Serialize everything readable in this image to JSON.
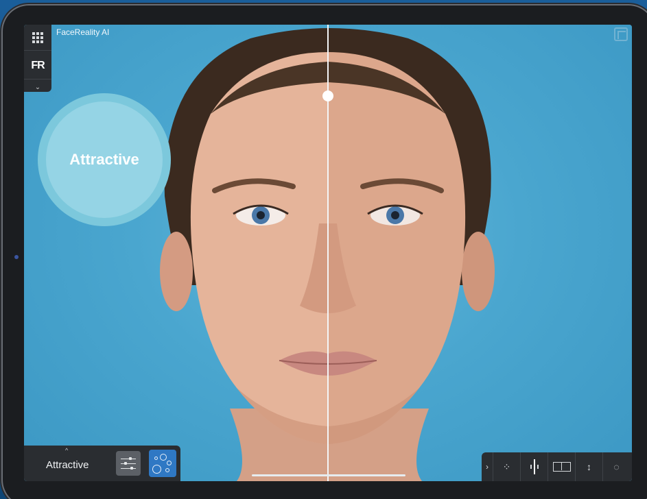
{
  "app": {
    "title": "FaceReality AI",
    "logo_text": "FR"
  },
  "bubble": {
    "label": "Attractive"
  },
  "bottom_panel": {
    "mode_label": "Attractive"
  },
  "colors": {
    "screen_background": "#47a5cc",
    "bubble_outer": "#7cc8dc",
    "bubble_inner": "#95d4e5",
    "panel_dark": "#2a2d31",
    "active_button": "#2f78c4"
  },
  "icons": {
    "menu": "grid-icon",
    "collapse": "chevron-down-icon",
    "expand_mode": "chevron-up-icon",
    "settings": "sliders-icon",
    "bubbles": "bubbles-icon",
    "fullscreen": "expand-icon",
    "toolbar": [
      "chevron-right-icon",
      "sparkle-icon",
      "divider-icon",
      "split-view-icon",
      "arrows-icon",
      "hide-eye-icon"
    ]
  },
  "toolbar_glyphs": {
    "expand": "›",
    "sparkle": "⁘",
    "arrows": "↕",
    "hide": "◌"
  },
  "carets": {
    "down": "⌄",
    "up": "^"
  },
  "comparison": {
    "divider_position": 0.5
  }
}
